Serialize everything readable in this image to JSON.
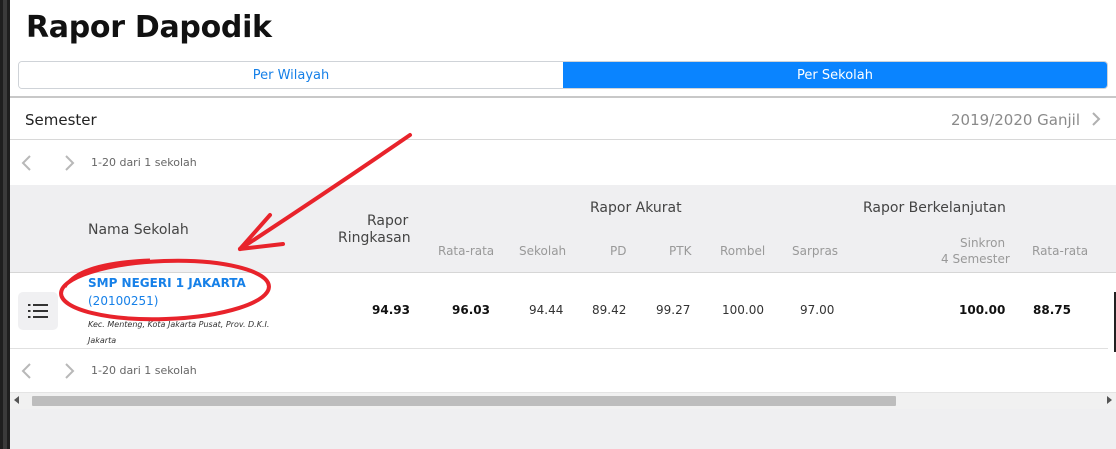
{
  "page": {
    "title": "Rapor Dapodik"
  },
  "tabs": [
    {
      "label": "Per Wilayah",
      "active": false
    },
    {
      "label": "Per Sekolah",
      "active": true
    }
  ],
  "semester": {
    "label": "Semester",
    "value": "2019/2020 Ganjil",
    "icon": "chevron-right-icon"
  },
  "pager": {
    "info": "1-20 dari 1 sekolah",
    "prev_icon": "chevron-left-icon",
    "next_icon": "chevron-right-icon"
  },
  "table": {
    "headers": {
      "nama_sekolah": "Nama Sekolah",
      "rapor_ringkasan_line1": "Rapor",
      "rapor_ringkasan_line2": "Ringkasan",
      "rapor_akurat": "Rapor Akurat",
      "rapor_berkelanjutan": "Rapor Berkelanjutan",
      "rata_rata": "Rata-rata",
      "sekolah": "Sekolah",
      "pd": "PD",
      "ptk": "PTK",
      "rombel": "Rombel",
      "sarpras": "Sarpras",
      "sinkron_line1": "Sinkron",
      "sinkron_line2": "4 Semester",
      "rata_rata_2": "Rata-rata"
    },
    "rows": [
      {
        "name": "SMP NEGERI 1 JAKARTA",
        "npsn": "(20100251)",
        "address": "Kec. Menteng, Kota Jakarta Pusat, Prov. D.K.I. Jakarta",
        "rapor_ringkasan": "94.93",
        "akurat_rata_rata": "96.03",
        "sekolah": "94.44",
        "pd": "89.42",
        "ptk": "99.27",
        "rombel": "100.00",
        "sarpras": "97.00",
        "sinkron": "100.00",
        "berkelanjutan_rata_rata": "88.75",
        "menu_icon": "list-icon"
      }
    ]
  },
  "colors": {
    "accent": "#0a84ff",
    "link": "#1680e8",
    "annotation": "#e8232b",
    "header_bg": "#efeff1"
  }
}
